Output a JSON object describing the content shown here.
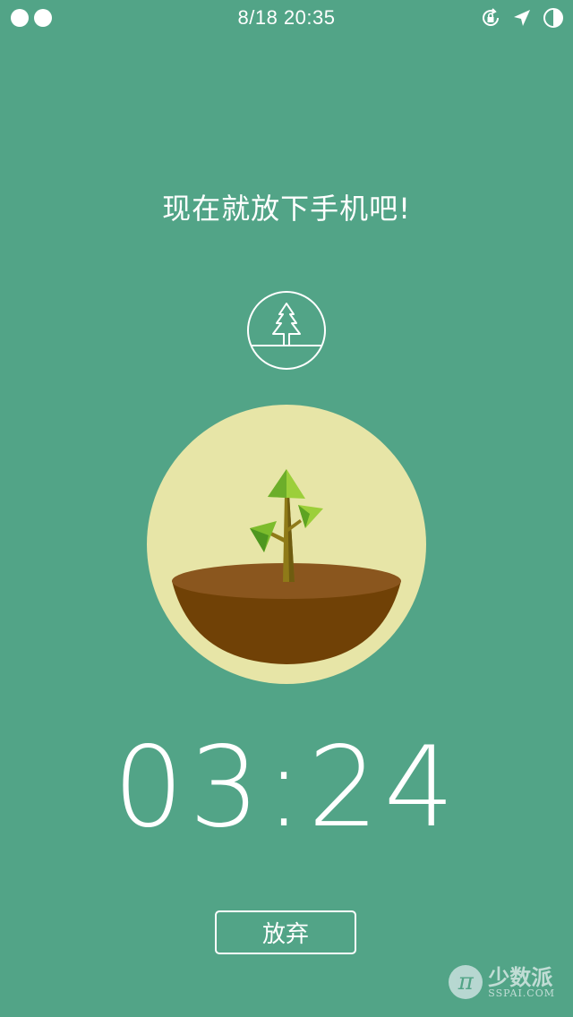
{
  "status_bar": {
    "time": "8/18 20:35",
    "icons": [
      "rotation-lock-icon",
      "location-arrow-icon",
      "half-circle-icon"
    ]
  },
  "headline": "现在就放下手机吧!",
  "mode_icon": "tree-icon",
  "illustration": "sapling-in-pot",
  "timer": {
    "minutes": "03",
    "separator": ":",
    "seconds": "24"
  },
  "give_up_label": "放弃",
  "watermark": {
    "logo_letter": "π",
    "title": "少数派",
    "subtitle": "SSPAI.COM"
  },
  "colors": {
    "background": "#52a487",
    "circle": "#e7e5a7",
    "soil_top": "#8a561e",
    "soil_body": "#704106",
    "leaf_light": "#9ccf3a",
    "leaf_dark": "#4e9620",
    "trunk": "#8f7a18"
  }
}
